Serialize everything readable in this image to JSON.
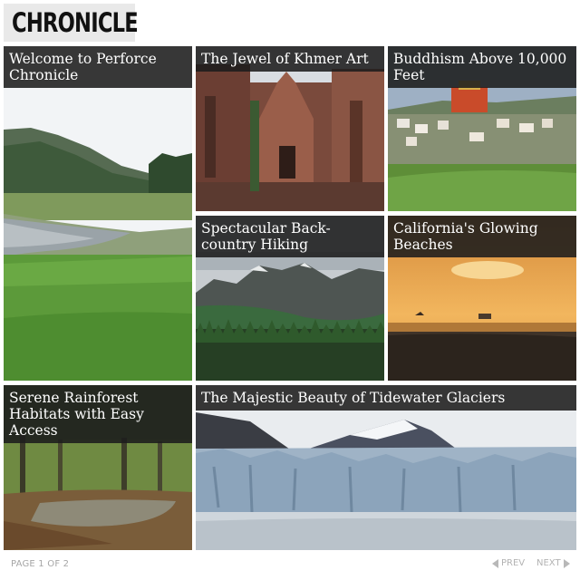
{
  "brand": {
    "name": "CHRONICLE"
  },
  "tiles": [
    {
      "title": "Welcome to Perforce Chronicle"
    },
    {
      "title": "The Jewel of Khmer Art"
    },
    {
      "title": "Buddhism Above 10,000 Feet"
    },
    {
      "title": "Spectacular Back-country Hiking"
    },
    {
      "title": "California's Glowing Beaches"
    },
    {
      "title": "Serene Rainforest Habitats with Easy Access"
    },
    {
      "title": "The Majestic Beauty of Tidewater Glaciers"
    }
  ],
  "pagination": {
    "status": "PAGE 1 OF 2",
    "prev_label": "PREV",
    "next_label": "NEXT"
  }
}
